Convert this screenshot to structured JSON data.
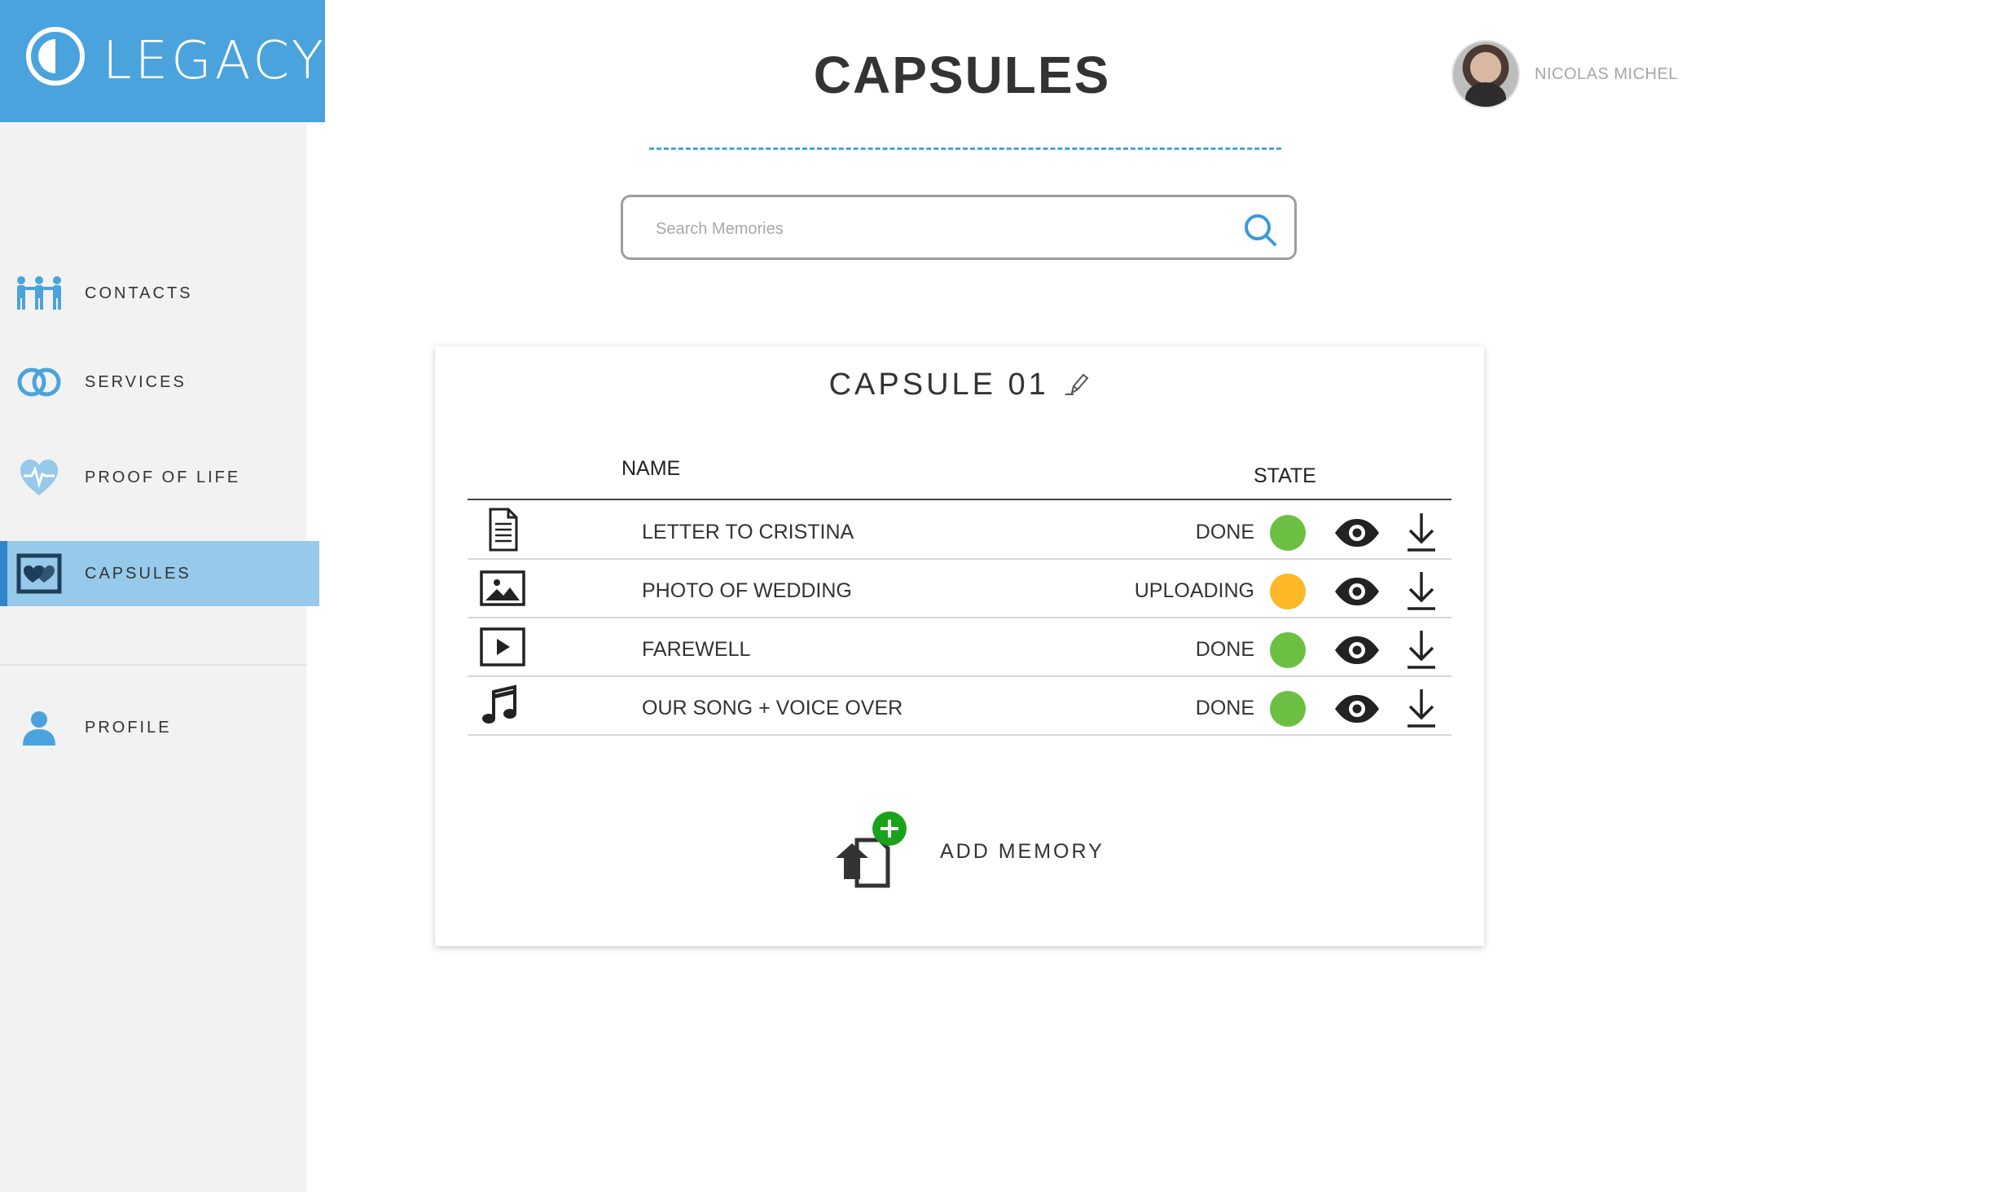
{
  "app": {
    "logo_text": "LEGACY"
  },
  "sidebar": {
    "items": [
      {
        "label": "CONTACTS",
        "icon": "contacts-icon",
        "active": false
      },
      {
        "label": "SERVICES",
        "icon": "rings-icon",
        "active": false
      },
      {
        "label": "PROOF OF LIFE",
        "icon": "heartbeat-icon",
        "active": false
      },
      {
        "label": "CAPSULES",
        "icon": "capsule-heart-icon",
        "active": true
      },
      {
        "label": "PROFILE",
        "icon": "user-icon",
        "active": false
      }
    ]
  },
  "header": {
    "title": "CAPSULES"
  },
  "user": {
    "name": "NICOLAS MICHEL"
  },
  "search": {
    "placeholder": "Search Memories",
    "value": ""
  },
  "capsule": {
    "title": "CAPSULE 01",
    "columns": {
      "name": "NAME",
      "state": "STATE"
    },
    "rows": [
      {
        "type_icon": "document-icon",
        "name": "LETTER TO CRISTINA",
        "state": "DONE",
        "state_color": "#6cbf43"
      },
      {
        "type_icon": "image-icon",
        "name": "PHOTO OF WEDDING",
        "state": "UPLOADING",
        "state_color": "#fcb827"
      },
      {
        "type_icon": "video-icon",
        "name": "FAREWELL",
        "state": "DONE",
        "state_color": "#6cbf43"
      },
      {
        "type_icon": "music-icon",
        "name": "OUR SONG + VOICE OVER",
        "state": "DONE",
        "state_color": "#6cbf43"
      }
    ],
    "add_label": "ADD MEMORY"
  },
  "colors": {
    "brand": "#4aa3dd",
    "active_nav": "#96c9ea",
    "done": "#6cbf43",
    "uploading": "#fcb827",
    "add_plus": "#1aa31a"
  }
}
